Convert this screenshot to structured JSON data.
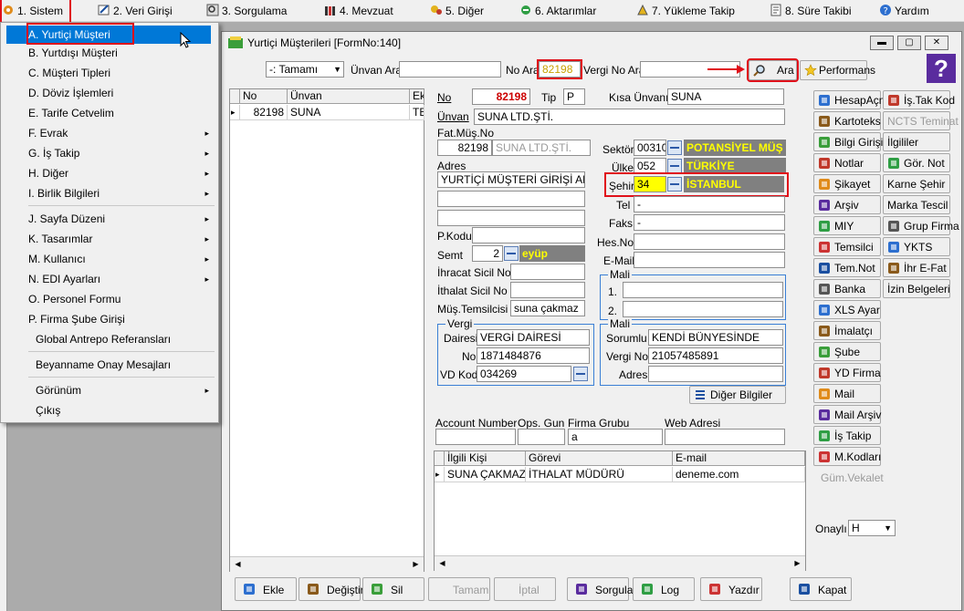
{
  "menubar": {
    "items": [
      {
        "label": "1.  Sistem",
        "icon": "system-icon"
      },
      {
        "label": "2.  Veri Girişi",
        "icon": "data-entry-icon"
      },
      {
        "label": "3.  Sorgulama",
        "icon": "query-icon"
      },
      {
        "label": "4.  Mevzuat",
        "icon": "legislation-icon"
      },
      {
        "label": "5.  Diğer",
        "icon": "other-icon"
      },
      {
        "label": "6.  Aktarımlar",
        "icon": "transfer-icon"
      },
      {
        "label": "7.  Yükleme Takip",
        "icon": "upload-tracking-icon"
      },
      {
        "label": "8. Süre Takibi",
        "icon": "time-tracking-icon"
      },
      {
        "label": "Yardım",
        "icon": "help-icon"
      }
    ]
  },
  "system_menu": {
    "items": [
      {
        "label": "A.  Yurtiçi Müşteri",
        "submenu": false
      },
      {
        "label": "B.  Yurtdışı Müşteri",
        "submenu": false
      },
      {
        "label": "C.  Müşteri Tipleri",
        "submenu": false
      },
      {
        "label": "D.  Döviz İşlemleri",
        "submenu": false
      },
      {
        "label": "E.  Tarife Cetvelim",
        "submenu": false
      },
      {
        "label": "F.  Evrak",
        "submenu": true
      },
      {
        "label": "G.  İş Takip",
        "submenu": true
      },
      {
        "label": "H.  Diğer",
        "submenu": true
      },
      {
        "label": "I.  Birlik Bilgileri",
        "submenu": true
      },
      {
        "label": "J.  Sayfa Düzeni",
        "submenu": true
      },
      {
        "label": "K.  Tasarımlar",
        "submenu": true
      },
      {
        "label": "M.  Kullanıcı",
        "submenu": true
      },
      {
        "label": "N.  EDI Ayarları",
        "submenu": true
      },
      {
        "label": "O.  Personel Formu",
        "submenu": false
      },
      {
        "label": "P.  Firma Şube Girişi",
        "submenu": false
      },
      {
        "label": "Global Antrepo Referansları",
        "submenu": false
      },
      {
        "label": "Beyanname Onay Mesajları",
        "submenu": false
      },
      {
        "label": "Görünüm",
        "submenu": true
      },
      {
        "label": "Çıkış",
        "submenu": false
      }
    ],
    "arrow": "▸"
  },
  "window": {
    "title": "Yurtiçi Müşterileri [FormNo:140]",
    "min": "▬",
    "max": "▢",
    "close": "✕"
  },
  "search": {
    "filter_value": "-: Tamamı",
    "unvan_label": "Ünvan Ara",
    "unvan_value": "",
    "no_label": "No Ara",
    "no_value": "82198",
    "vergi_label": "Vergi No Ara",
    "vergi_value": "",
    "search_button": "Ara",
    "performans_button": "Performans",
    "help": "?"
  },
  "list": {
    "columns": [
      "No",
      "Ünvan",
      "Ek"
    ],
    "rows": [
      {
        "marker": "▸",
        "no": "82198",
        "unvan": "SUNA",
        "ek": "TE"
      }
    ]
  },
  "form": {
    "no_label": "No",
    "no_value": "82198",
    "tip_label": "Tip",
    "tip_value": "P",
    "kisa_label": "Kısa Ünvanı",
    "kisa_value": "SUNA",
    "unvan_label": "Ünvan",
    "unvan_value": "SUNA  LTD.ŞTİ.",
    "fat_label": "Fat.Müş.No",
    "fat_no": "82198",
    "fat_name": "SUNA  LTD.ŞTİ.",
    "adres_label": "Adres",
    "adres_value": "YURTİÇİ MÜŞTERİ GİRİŞİ ADRESİ",
    "sektor_label": "Sektör",
    "sektor_value": "00310(",
    "sektor_name": "POTANSİYEL MÜŞ",
    "ulke_label": "Ülke",
    "ulke_value": "052",
    "ulke_name": "TÜRKİYE",
    "sehir_label": "Şehir",
    "sehir_value": "34",
    "sehir_name": "İSTANBUL",
    "tel_label": "Tel",
    "tel_value": "-",
    "faks_label": "Faks",
    "faks_value": "-",
    "hesno_label": "Hes.No",
    "hesno_value": "",
    "email_label": "E-Mail",
    "email_value": "",
    "pkodu_label": "P.Kodu",
    "pkodu_value": "",
    "semt_label": "Semt",
    "semt_value": "2",
    "semt_name": "eyüp",
    "ihracat_label": "İhracat Sicil No",
    "ihracat_value": "",
    "ithalat_label": "İthalat Sicil No",
    "ithalat_value": "",
    "temsilci_label": "Müş.Temsilcisi 2",
    "temsilci_value": "suna çakmaz",
    "mali_label": "Mali",
    "mali1_label": "1.",
    "mali2_label": "2.",
    "vergi_group": "Vergi",
    "vdaire_label": "Dairesi",
    "vdaire_value": "VERGİ DAİRESİ",
    "vno_label": "No",
    "vno_value": "1871484876",
    "vdkod_label": "VD Kod",
    "vdkod_value": "034269",
    "mali_sorumlu_group": "Mali",
    "sorumlu_label": "Sorumlu",
    "sorumlu_value": "KENDİ BÜNYESİNDE",
    "mvno_label": "Vergi No",
    "mvno_value": "21057485891",
    "madres_label": "Adres",
    "madres_value": "",
    "diger_button": "Diğer Bilgiler",
    "account_label": "Account Number",
    "ops_label": "Ops. Gun",
    "firma_grubu_label": "Firma Grubu",
    "firma_grubu_value": "a",
    "web_label": "Web Adresi"
  },
  "contacts": {
    "columns": [
      "İlgili Kişi",
      "Görevi",
      "E-mail"
    ],
    "rows": [
      {
        "marker": "▸",
        "kisi": "SUNA ÇAKMAZ",
        "gorev": "İTHALAT MÜDÜRÜ",
        "email": "deneme.com"
      }
    ]
  },
  "side_buttons": {
    "left": [
      {
        "label": "HesapAçm",
        "icon": "account-icon"
      },
      {
        "label": "Kartoteks",
        "icon": "cards-icon"
      },
      {
        "label": "Bilgi Girişi",
        "icon": "info-entry-icon"
      },
      {
        "label": "Notlar",
        "icon": "notes-icon"
      },
      {
        "label": "Şikayet",
        "icon": "complaint-icon"
      },
      {
        "label": "Arşiv",
        "icon": "archive-icon"
      },
      {
        "label": "MIY",
        "icon": "miy-icon"
      },
      {
        "label": "Temsilci",
        "icon": "representative-icon"
      },
      {
        "label": "Tem.Not",
        "icon": "rep-note-icon"
      },
      {
        "label": "Banka",
        "icon": "bank-icon"
      },
      {
        "label": "XLS Ayar",
        "icon": "xls-icon"
      },
      {
        "label": "İmalatçı",
        "icon": "manufacturer-icon"
      },
      {
        "label": "Şube",
        "icon": "branch-icon"
      },
      {
        "label": "YD Firma",
        "icon": "foreign-firm-icon"
      },
      {
        "label": "Mail",
        "icon": "mail-icon"
      },
      {
        "label": "Mail Arşiv",
        "icon": "mail-archive-icon"
      },
      {
        "label": "İş Takip",
        "icon": "task-tracking-icon"
      },
      {
        "label": "M.Kodları",
        "icon": "codes-icon"
      }
    ],
    "right": [
      {
        "label": "İş.Tak Kod",
        "icon": "task-code-icon"
      },
      {
        "label": "NCTS Teminat",
        "icon": ""
      },
      {
        "label": "İlgililer",
        "icon": ""
      },
      {
        "label": "Gör. Not",
        "icon": "view-note-icon"
      },
      {
        "label": "Karne Şehir",
        "icon": ""
      },
      {
        "label": "Marka Tescil",
        "icon": ""
      },
      {
        "label": "Grup Firma",
        "icon": "group-firm-icon"
      },
      {
        "label": "YKTS",
        "icon": "check-icon"
      },
      {
        "label": "İhr E-Fat",
        "icon": "einvoice-icon"
      },
      {
        "label": "İzin Belgeleri",
        "icon": ""
      }
    ],
    "gum_vekalet": "Güm.Vekalet",
    "onayli_label": "Onaylı",
    "onayli_value": "H"
  },
  "toolbar": {
    "buttons": [
      {
        "label": "Ekle",
        "icon": "add-icon"
      },
      {
        "label": "Değiştir",
        "icon": "edit-icon"
      },
      {
        "label": "Sil",
        "icon": "delete-icon"
      },
      {
        "label": "Tamam",
        "icon": ""
      },
      {
        "label": "İptal",
        "icon": ""
      },
      {
        "label": "Sorgula",
        "icon": "query-icon"
      },
      {
        "label": "Log",
        "icon": "log-icon"
      },
      {
        "label": "Yazdır",
        "icon": "print-icon"
      },
      {
        "label": "Kapat",
        "icon": "close-icon"
      }
    ]
  },
  "colors": {
    "highlight": "#e0101a",
    "selection": "#0078d7",
    "status_yellow": "#ffff00"
  }
}
